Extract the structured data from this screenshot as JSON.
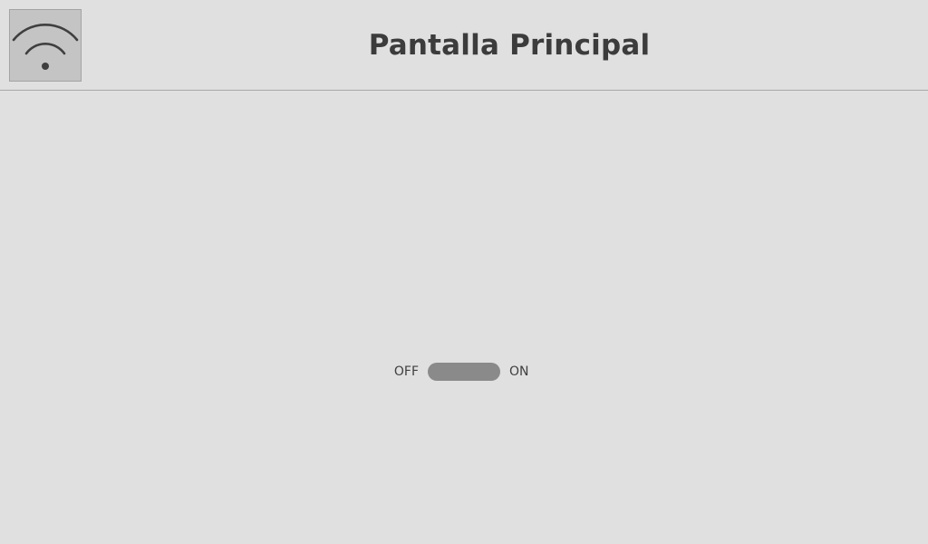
{
  "header": {
    "title": "Pantalla Principal",
    "wifi_icon": "wifi-icon"
  },
  "switch": {
    "off_label": "OFF",
    "on_label": "ON",
    "state": "off"
  },
  "colors": {
    "background": "#e0e0e0",
    "button_bg": "#c4c4c4",
    "toggle_track": "#8a8a8a",
    "text": "#3c3c3c"
  }
}
